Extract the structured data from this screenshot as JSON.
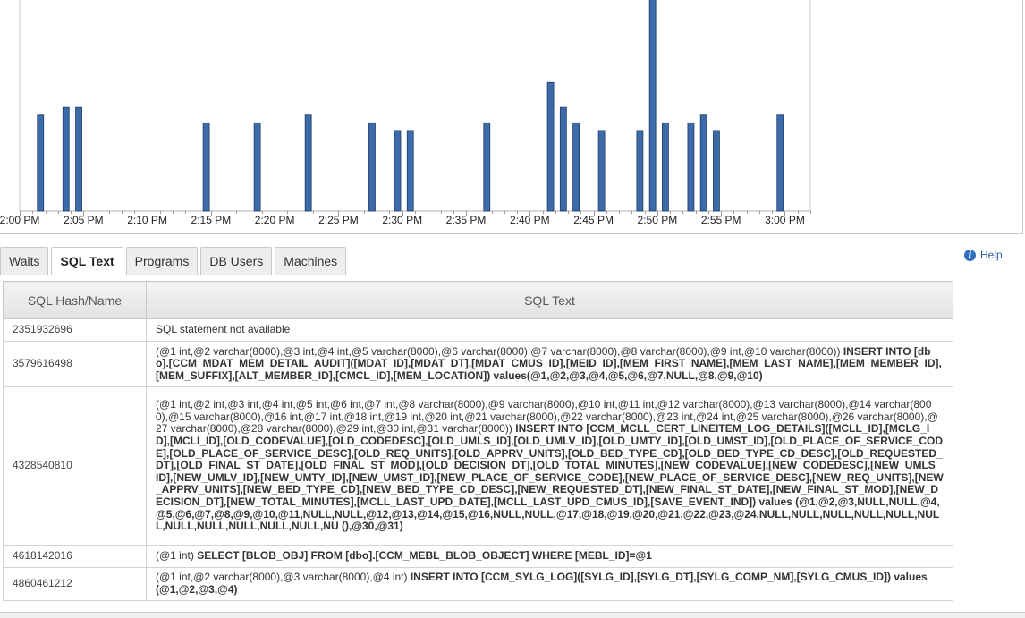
{
  "chart_data": {
    "type": "bar",
    "x_tick_labels": [
      "2:00 PM",
      "2:05 PM",
      "2:10 PM",
      "2:15 PM",
      "2:20 PM",
      "2:25 PM",
      "2:30 PM",
      "2:35 PM",
      "2:40 PM",
      "2:45 PM",
      "2:50 PM",
      "2:55 PM",
      "3:00 PM"
    ],
    "x_range_minutes": [
      0,
      62
    ],
    "ylim": [
      0,
      1.1
    ],
    "bar_color": "#3d6aa8",
    "bars": [
      {
        "minute": 1,
        "value": 0.5
      },
      {
        "minute": 3,
        "value": 0.54
      },
      {
        "minute": 4,
        "value": 0.54
      },
      {
        "minute": 14,
        "value": 0.46
      },
      {
        "minute": 18,
        "value": 0.46
      },
      {
        "minute": 22,
        "value": 0.5
      },
      {
        "minute": 27,
        "value": 0.46
      },
      {
        "minute": 29,
        "value": 0.42
      },
      {
        "minute": 30,
        "value": 0.42
      },
      {
        "minute": 36,
        "value": 0.46
      },
      {
        "minute": 41,
        "value": 0.67
      },
      {
        "minute": 42,
        "value": 0.54
      },
      {
        "minute": 43,
        "value": 0.46
      },
      {
        "minute": 45,
        "value": 0.42
      },
      {
        "minute": 48,
        "value": 0.42
      },
      {
        "minute": 49,
        "value": 1.15
      },
      {
        "minute": 50,
        "value": 0.46
      },
      {
        "minute": 52,
        "value": 0.46
      },
      {
        "minute": 53,
        "value": 0.5
      },
      {
        "minute": 54,
        "value": 0.42
      },
      {
        "minute": 59,
        "value": 0.5
      }
    ]
  },
  "tabs": [
    {
      "label": "Waits",
      "active": false
    },
    {
      "label": "SQL Text",
      "active": true
    },
    {
      "label": "Programs",
      "active": false
    },
    {
      "label": "DB Users",
      "active": false
    },
    {
      "label": "Machines",
      "active": false
    }
  ],
  "help": {
    "label": "Help",
    "icon": "info-icon"
  },
  "table": {
    "headers": [
      "SQL Hash/Name",
      "SQL Text"
    ],
    "rows": [
      {
        "hash": "2351932696",
        "params": "SQL statement not available",
        "body": ""
      },
      {
        "hash": "3579616498",
        "params": "(@1 int,@2 varchar(8000),@3 int,@4 int,@5 varchar(8000),@6 varchar(8000),@7 varchar(8000),@8 varchar(8000),@9 int,@10 varchar(8000)) ",
        "body": "INSERT INTO [dbo].[CCM_MDAT_MEM_DETAIL_AUDIT]([MDAT_ID],[MDAT_DT],[MDAT_CMUS_ID],[MEID_ID],[MEM_FIRST_NAME],[MEM_LAST_NAME],[MEM_MEMBER_ID],[MEM_SUFFIX],[ALT_MEMBER_ID],[CMCL_ID],[MEM_LOCATION]) values(@1,@2,@3,@4,@5,@6,@7,NULL,@8,@9,@10)"
      },
      {
        "hash": "4328540810",
        "params": "(@1 int,@2 int,@3 int,@4 int,@5 int,@6 int,@7 int,@8 varchar(8000),@9 varchar(8000),@10 int,@11 int,@12 varchar(8000),@13 varchar(8000),@14 varchar(8000),@15 varchar(8000),@16 int,@17 int,@18 int,@19 int,@20 int,@21 varchar(8000),@22 varchar(8000),@23 int,@24 int,@25 varchar(8000),@26 varchar(8000),@27 varchar(8000),@28 varchar(8000),@29 int,@30 int,@31 varchar(8000)) ",
        "body": "INSERT INTO [CCM_MCLL_CERT_LINEITEM_LOG_DETAILS]([MCLL_ID],[MCLG_ID],[MCLI_ID],[OLD_CODEVALUE],[OLD_CODEDESC],[OLD_UMLS_ID],[OLD_UMLV_ID],[OLD_UMTY_ID],[OLD_UMST_ID],[OLD_PLACE_OF_SERVICE_CODE],[OLD_PLACE_OF_SERVICE_DESC],[OLD_REQ_UNITS],[OLD_APPRV_UNITS],[OLD_BED_TYPE_CD],[OLD_BED_TYPE_CD_DESC],[OLD_REQUESTED_DT],[OLD_FINAL_ST_DATE],[OLD_FINAL_ST_MOD],[OLD_DECISION_DT],[OLD_TOTAL_MINUTES],[NEW_CODEVALUE],[NEW_CODEDESC],[NEW_UMLS_ID],[NEW_UMLV_ID],[NEW_UMTY_ID],[NEW_UMST_ID],[NEW_PLACE_OF_SERVICE_CODE],[NEW_PLACE_OF_SERVICE_DESC],[NEW_REQ_UNITS],[NEW_APPRV_UNITS],[NEW_BED_TYPE_CD],[NEW_BED_TYPE_CD_DESC],[NEW_REQUESTED_DT],[NEW_FINAL_ST_DATE],[NEW_FINAL_ST_MOD],[NEW_DECISION_DT],[NEW_TOTAL_MINUTES],[MCLL_LAST_UPD_DATE],[MCLL_LAST_UPD_CMUS_ID],[SAVE_EVENT_IND]) values (@1,@2,@3,NULL,NULL,@4,@5,@6,@7,@8,@9,@10,@11,NULL,NULL,@12,@13,@14,@15,@16,NULL,NULL,@17,@18,@19,@20,@21,@22,@23,@24,NULL,NULL,NULL,NULL,NULL,NULL,NULL,NULL,NULL,NULL,NULL,NU (),@30,@31)"
      },
      {
        "hash": "4618142016",
        "params": "(@1 int) ",
        "body": "SELECT [BLOB_OBJ] FROM [dbo].[CCM_MEBL_BLOB_OBJECT] WHERE [MEBL_ID]=@1"
      },
      {
        "hash": "4860461212",
        "params": "(@1 int,@2 varchar(8000),@3 varchar(8000),@4 int) ",
        "body": "INSERT INTO [CCM_SYLG_LOG]([SYLG_ID],[SYLG_DT],[SYLG_COMP_NM],[SYLG_CMUS_ID]) values (@1,@2,@3,@4)"
      }
    ]
  }
}
